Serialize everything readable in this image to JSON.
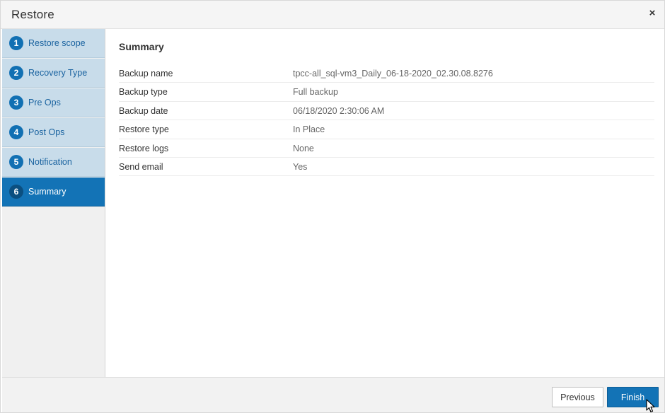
{
  "window": {
    "title": "Restore",
    "close_glyph": "×"
  },
  "steps": [
    {
      "num": "1",
      "label": "Restore scope",
      "active": false
    },
    {
      "num": "2",
      "label": "Recovery Type",
      "active": false
    },
    {
      "num": "3",
      "label": "Pre Ops",
      "active": false
    },
    {
      "num": "4",
      "label": "Post Ops",
      "active": false
    },
    {
      "num": "5",
      "label": "Notification",
      "active": false
    },
    {
      "num": "6",
      "label": "Summary",
      "active": true
    }
  ],
  "summary": {
    "heading": "Summary",
    "rows": [
      {
        "key": "Backup name",
        "value": "tpcc-all_sql-vm3_Daily_06-18-2020_02.30.08.8276"
      },
      {
        "key": "Backup type",
        "value": "Full backup"
      },
      {
        "key": "Backup date",
        "value": "06/18/2020 2:30:06 AM"
      },
      {
        "key": "Restore type",
        "value": "In Place"
      },
      {
        "key": "Restore logs",
        "value": "None"
      },
      {
        "key": "Send email",
        "value": "Yes"
      }
    ]
  },
  "footer": {
    "previous_label": "Previous",
    "finish_label": "Finish"
  },
  "colors": {
    "accent": "#1373b6",
    "step_bg": "#c8dcea",
    "step_text": "#1a63a0"
  },
  "icons": {
    "close": "close-icon",
    "cursor": "mouse-pointer-icon"
  }
}
